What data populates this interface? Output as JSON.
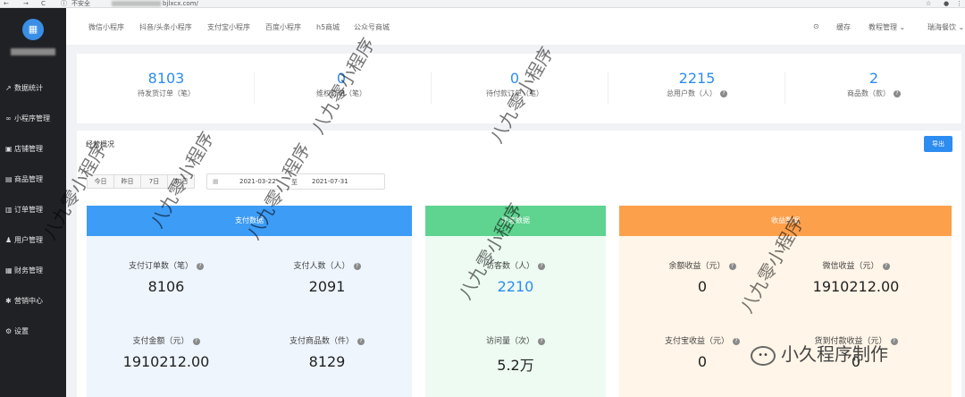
{
  "browser": {
    "insecure_label": "不安全",
    "url_fragment": "bjlxcx.com/"
  },
  "sidebar": {
    "logo_glyph": "▦",
    "items": [
      {
        "label": "数据统计",
        "icon": "chart-icon",
        "glyph": "↗"
      },
      {
        "label": "小程序管理",
        "icon": "link-icon",
        "glyph": "∞"
      },
      {
        "label": "店铺管理",
        "icon": "shop-icon",
        "glyph": "▣"
      },
      {
        "label": "商品管理",
        "icon": "product-icon",
        "glyph": "▤"
      },
      {
        "label": "订单管理",
        "icon": "order-icon",
        "glyph": "▥"
      },
      {
        "label": "用户管理",
        "icon": "user-icon",
        "glyph": "♟"
      },
      {
        "label": "财务管理",
        "icon": "finance-icon",
        "glyph": "▦"
      },
      {
        "label": "营销中心",
        "icon": "marketing-icon",
        "glyph": "✱"
      },
      {
        "label": "设置",
        "icon": "gear-icon",
        "glyph": "⚙"
      }
    ]
  },
  "topbar": {
    "tabs": [
      "微信小程序",
      "抖音/头条小程序",
      "支付宝小程序",
      "百度小程序",
      "h5商城",
      "公众号商城"
    ],
    "cache": "缓存",
    "tutorial": "教程管理",
    "shop": "瑞海餐饮"
  },
  "stats": [
    {
      "value": "8103",
      "label": "待发货订单（笔）"
    },
    {
      "value": "0",
      "label": "维权订单（笔）"
    },
    {
      "value": "0",
      "label": "待付款订单（笔）"
    },
    {
      "value": "2215",
      "label": "总用户数（人）"
    },
    {
      "value": "2",
      "label": "商品数（款）"
    }
  ],
  "overview": {
    "title": "经营概况",
    "export": "导出",
    "ranges": [
      "今日",
      "昨日",
      "7日",
      "30日"
    ],
    "date_start": "2021-03-22",
    "date_to": "至",
    "date_end": "2021-07-31"
  },
  "cards": {
    "pay": {
      "title": "支付数据",
      "color": "#3d9cf5",
      "bg": "#eef5fd",
      "metrics": [
        {
          "label": "支付订单数（笔）",
          "value": "8106"
        },
        {
          "label": "支付人数（人）",
          "value": "2091"
        },
        {
          "label": "支付金额（元）",
          "value": "1910212.00"
        },
        {
          "label": "支付商品数（件）",
          "value": "8129"
        }
      ]
    },
    "visit": {
      "title": "访客数据",
      "color": "#5fd390",
      "bg": "#edfbf2",
      "metrics": [
        {
          "label": "访客数（人）",
          "value": "2210"
        },
        {
          "label": "访问量（次）",
          "value": "5.2万"
        }
      ]
    },
    "income": {
      "title": "收益数据",
      "color": "#fca04c",
      "bg": "#fff5e8",
      "metrics": [
        {
          "label": "余额收益（元）",
          "value": "0"
        },
        {
          "label": "微信收益（元）",
          "value": "1910212.00"
        },
        {
          "label": "支付宝收益（元）",
          "value": "0"
        },
        {
          "label": "货到付款收益（元）",
          "value": "0"
        }
      ]
    }
  },
  "watermark": "八九零小程序",
  "brand": "小久程序制作"
}
